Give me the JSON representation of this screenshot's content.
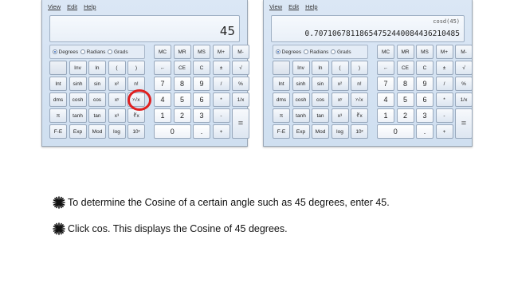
{
  "menu": [
    "View",
    "Edit",
    "Help"
  ],
  "left_calc": {
    "display_expression": "",
    "display_value": "45"
  },
  "right_calc": {
    "display_expression": "cosd(45)",
    "display_value": "0.70710678118654752440084436210485"
  },
  "angle_units": [
    "Degrees",
    "Radians",
    "Grads"
  ],
  "selected_unit": "Degrees",
  "memory_keys": [
    "MC",
    "MR",
    "MS",
    "M+",
    "M-"
  ],
  "rows": [
    [
      "",
      "Inv",
      "ln",
      "(",
      ")",
      "←",
      "CE",
      "C",
      "±",
      "√"
    ],
    [
      "Int",
      "sinh",
      "sin",
      "x²",
      "n!",
      "7",
      "8",
      "9",
      "/",
      "%"
    ],
    [
      "dms",
      "cosh",
      "cos",
      "xʸ",
      "ʸ√x",
      "4",
      "5",
      "6",
      "*",
      "1/x"
    ],
    [
      "π",
      "tanh",
      "tan",
      "x³",
      "∛x",
      "1",
      "2",
      "3",
      "-",
      "="
    ],
    [
      "F-E",
      "Exp",
      "Mod",
      "log",
      "10ˣ",
      "0",
      ".",
      "+"
    ]
  ],
  "highlighted_key": "cos",
  "instructions": [
    "To determine the Cosine of a certain angle such as 45 degrees, enter 45.",
    "Click cos. This displays the Cosine of 45 degrees."
  ],
  "colors": {
    "highlight": "#e02020",
    "window_bg": "#d5e3f3"
  }
}
